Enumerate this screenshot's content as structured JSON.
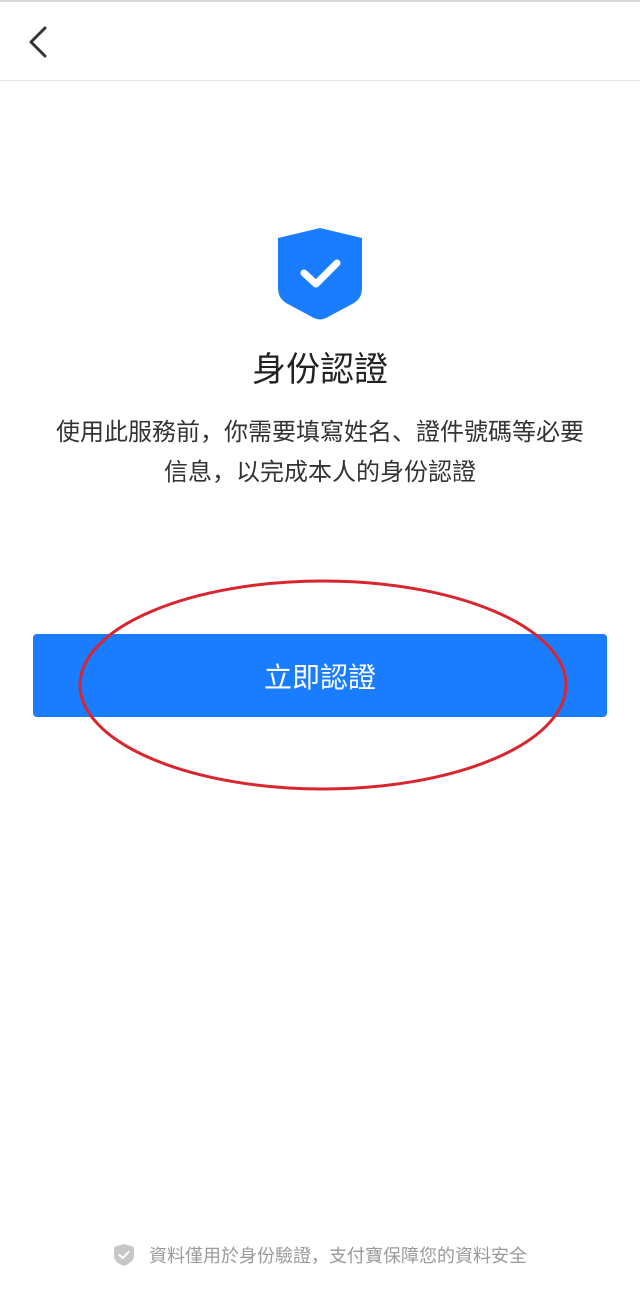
{
  "nav": {
    "back_icon": "chevron-left-icon"
  },
  "hero": {
    "icon": "shield-check-icon",
    "title": "身份認證",
    "description_line1": "使用此服務前，你需要填寫姓名、證件號碼等必要",
    "description_line2": "信息，以完成本人的身份認證"
  },
  "actions": {
    "verify_label": "立即認證"
  },
  "footer": {
    "icon": "shield-icon",
    "text": "資料僅用於身份驗證，支付寶保障您的資料安全"
  },
  "colors": {
    "accent": "#1a7dff",
    "annotation": "#d9252f",
    "footer_text": "#9a9a9a"
  }
}
